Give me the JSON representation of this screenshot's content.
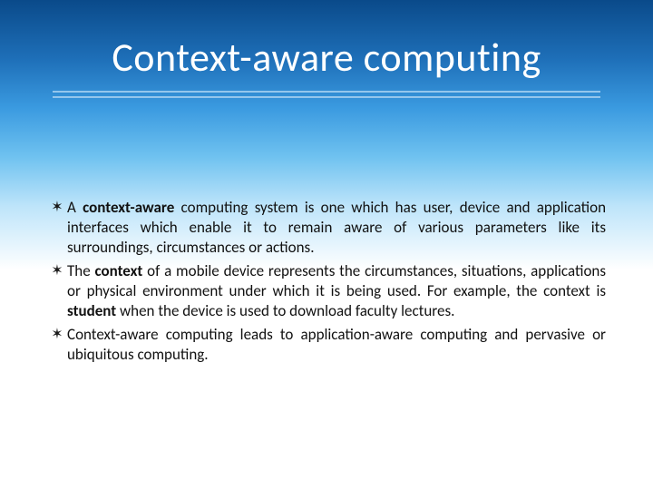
{
  "title": "Context-aware computing",
  "bullets": [
    {
      "pre": "A ",
      "bold1": "context-aware",
      "post": " computing system is one which has user, device and application interfaces which enable it to remain aware of various parameters like its surroundings, circumstances or actions."
    },
    {
      "pre": "The ",
      "bold1": "context",
      "mid": " of a mobile device represents the circumstances, situations, applications or physical environment under which it is being used. For example, the context is ",
      "bold2": "student",
      "post": " when the device is used to download faculty lectures."
    },
    {
      "pre": "Context-aware computing leads to application-aware computing and pervasive or ubiquitous computing.",
      "bold1": "",
      "post": ""
    }
  ],
  "marker": "✶"
}
